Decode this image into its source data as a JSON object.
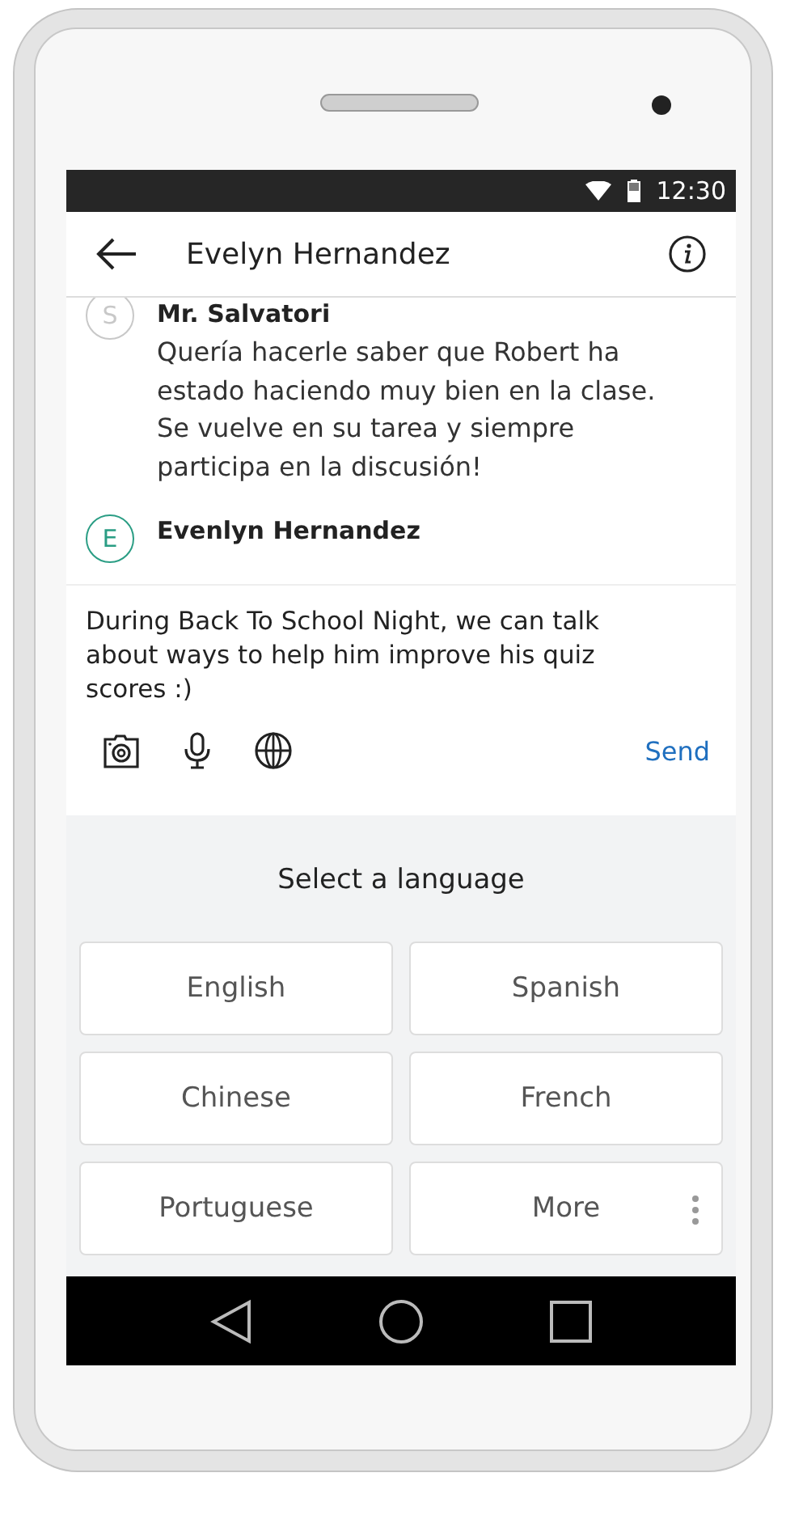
{
  "status_bar": {
    "time": "12:30"
  },
  "app_bar": {
    "title": "Evelyn Hernandez"
  },
  "messages": [
    {
      "initial": "S",
      "sender": "Mr. Salvatori",
      "text": "Quería hacerle saber que Robert ha estado haciendo muy bien en la clase. Se vuelve en su tarea y siempre participa en la discusión!",
      "color": "#c8c8c8"
    },
    {
      "initial": "E",
      "sender": "Evenlyn Hernandez",
      "color": "#2a9d84"
    }
  ],
  "composer": {
    "value": "During Back To School Night, we can talk about ways to help him improve his quiz scores :)",
    "send": "Send"
  },
  "language_panel": {
    "title": "Select a language",
    "options": [
      {
        "label": "English",
        "kind": "language"
      },
      {
        "label": "Spanish",
        "kind": "language"
      },
      {
        "label": "Chinese",
        "kind": "language"
      },
      {
        "label": "French",
        "kind": "language"
      },
      {
        "label": "Portuguese",
        "kind": "language"
      },
      {
        "label": "More",
        "kind": "more"
      }
    ]
  }
}
